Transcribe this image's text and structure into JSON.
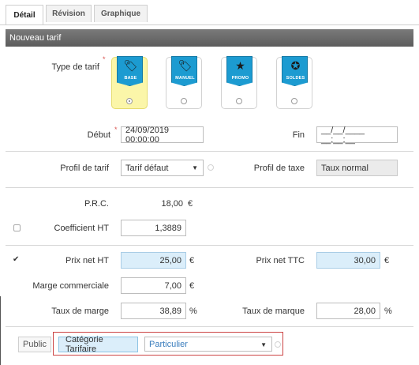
{
  "tabs": [
    {
      "label": "Détail",
      "active": true
    },
    {
      "label": "Révision",
      "active": false
    },
    {
      "label": "Graphique",
      "active": false
    }
  ],
  "section": {
    "title": "Nouveau tarif"
  },
  "type_tarif": {
    "label": "Type de tarif",
    "required_mark": "*",
    "options": [
      {
        "name": "BASE",
        "icon": "tag-icon",
        "selected": true
      },
      {
        "name": "MANUEL",
        "icon": "tag-icon",
        "selected": false
      },
      {
        "name": "PROMO",
        "icon": "star-icon",
        "selected": false
      },
      {
        "name": "SOLDES",
        "icon": "badge-icon",
        "selected": false
      }
    ]
  },
  "debut": {
    "label": "Début",
    "required_mark": "*",
    "value": "24/09/2019 00:00:00"
  },
  "fin": {
    "label": "Fin",
    "value": "__/__/____ __:__:__"
  },
  "profil_tarif": {
    "label": "Profil de tarif",
    "value": "Tarif défaut"
  },
  "profil_taxe": {
    "label": "Profil de taxe",
    "value": "Taux normal"
  },
  "prc": {
    "label": "P.R.C.",
    "value": "18,00",
    "unit": "€"
  },
  "coefficient": {
    "label": "Coefficient HT",
    "value": "1,3889",
    "checked": false
  },
  "prix_net_ht": {
    "label": "Prix net HT",
    "value": "25,00",
    "unit": "€",
    "checked": true
  },
  "prix_net_ttc": {
    "label": "Prix net TTC",
    "value": "30,00",
    "unit": "€"
  },
  "marge": {
    "label": "Marge commerciale",
    "value": "7,00",
    "unit": "€"
  },
  "taux_marge": {
    "label": "Taux de marge",
    "value": "38,89",
    "unit": "%"
  },
  "taux_marque": {
    "label": "Taux de marque",
    "value": "28,00",
    "unit": "%"
  },
  "audience": {
    "buttons": [
      {
        "label": "Public",
        "active": false
      },
      {
        "label": "Catégorie Tarifaire",
        "active": true
      }
    ],
    "select_value": "Particulier"
  },
  "colors": {
    "accent": "#1c9bd1",
    "selected_tile": "#fbf6a9",
    "highlight_input": "#dbeefa",
    "required": "#d9534f",
    "red_outline": "#c44444"
  }
}
